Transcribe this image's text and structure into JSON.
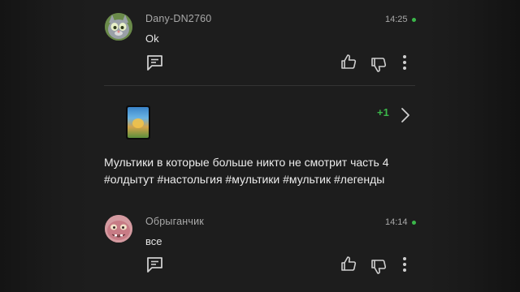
{
  "comments": [
    {
      "username": "Dany-DN2760",
      "time": "14:25",
      "text": "Ok",
      "avatar_icon": "talking-tom-avatar"
    },
    {
      "username": "Обрыганчик",
      "time": "14:14",
      "text": "все",
      "avatar_icon": "pink-creature-avatar"
    }
  ],
  "post": {
    "reaction_count": "+1",
    "description": "Мультики в которые больше никто не смотрит часть 4 #олдытут #настольгия #мультики #мультик #легенды",
    "thumbnail_icon": "cartoon-thumbnail"
  },
  "colors": {
    "panel_bg": "#1d1d1d",
    "accent_green": "#3bb74a",
    "muted_text": "#a9a9a9"
  }
}
